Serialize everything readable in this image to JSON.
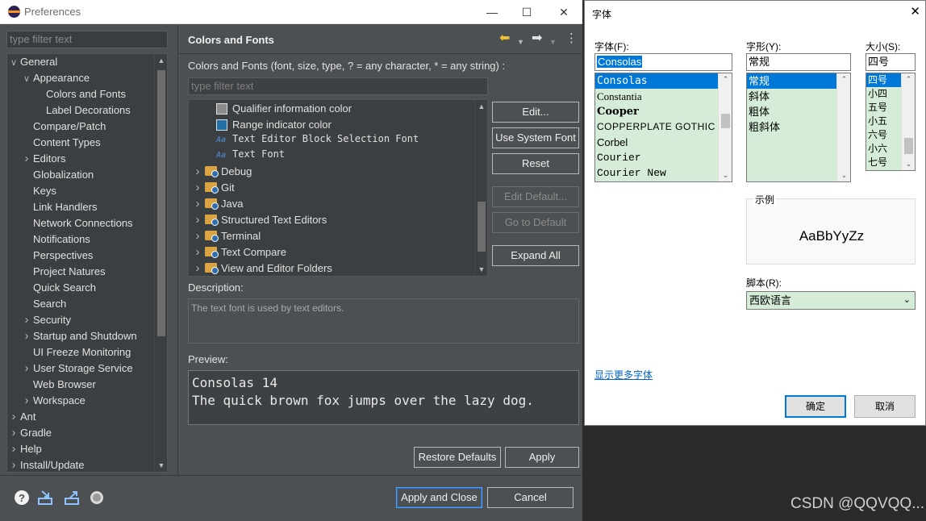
{
  "preferences": {
    "window_title": "Preferences",
    "filter_placeholder": "type filter text",
    "tree_items": [
      {
        "label": "General",
        "indent": 0,
        "arrow": "expanded"
      },
      {
        "label": "Appearance",
        "indent": 1,
        "arrow": "expanded"
      },
      {
        "label": "Colors and Fonts",
        "indent": 2,
        "arrow": "none"
      },
      {
        "label": "Label Decorations",
        "indent": 2,
        "arrow": "none"
      },
      {
        "label": "Compare/Patch",
        "indent": 1,
        "arrow": "none"
      },
      {
        "label": "Content Types",
        "indent": 1,
        "arrow": "none"
      },
      {
        "label": "Editors",
        "indent": 1,
        "arrow": "collapsed"
      },
      {
        "label": "Globalization",
        "indent": 1,
        "arrow": "none"
      },
      {
        "label": "Keys",
        "indent": 1,
        "arrow": "none"
      },
      {
        "label": "Link Handlers",
        "indent": 1,
        "arrow": "none"
      },
      {
        "label": "Network Connections",
        "indent": 1,
        "arrow": "none"
      },
      {
        "label": "Notifications",
        "indent": 1,
        "arrow": "none"
      },
      {
        "label": "Perspectives",
        "indent": 1,
        "arrow": "none"
      },
      {
        "label": "Project Natures",
        "indent": 1,
        "arrow": "none"
      },
      {
        "label": "Quick Search",
        "indent": 1,
        "arrow": "none"
      },
      {
        "label": "Search",
        "indent": 1,
        "arrow": "none"
      },
      {
        "label": "Security",
        "indent": 1,
        "arrow": "collapsed"
      },
      {
        "label": "Startup and Shutdown",
        "indent": 1,
        "arrow": "collapsed"
      },
      {
        "label": "UI Freeze Monitoring",
        "indent": 1,
        "arrow": "none"
      },
      {
        "label": "User Storage Service",
        "indent": 1,
        "arrow": "collapsed"
      },
      {
        "label": "Web Browser",
        "indent": 1,
        "arrow": "none"
      },
      {
        "label": "Workspace",
        "indent": 1,
        "arrow": "collapsed"
      },
      {
        "label": "Ant",
        "indent": 0,
        "arrow": "collapsed"
      },
      {
        "label": "Gradle",
        "indent": 0,
        "arrow": "collapsed"
      },
      {
        "label": "Help",
        "indent": 0,
        "arrow": "collapsed"
      },
      {
        "label": "Install/Update",
        "indent": 0,
        "arrow": "collapsed"
      }
    ],
    "page_title": "Colors and Fonts",
    "intro": "Colors and Fonts (font, size, type, ? = any character, * = any string) :",
    "cf_filter_placeholder": "type filter text",
    "cf_items": [
      {
        "kind": "color",
        "label": "Qualifier information color",
        "color": "#8c8c8c"
      },
      {
        "kind": "color",
        "label": "Range indicator color",
        "color": "#1f6fa8"
      },
      {
        "kind": "font",
        "label": "Text Editor Block Selection Font",
        "icon": "Aa"
      },
      {
        "kind": "font",
        "label": "Text Font",
        "icon": "Aa"
      },
      {
        "kind": "folder",
        "label": "Debug"
      },
      {
        "kind": "folder",
        "label": "Git"
      },
      {
        "kind": "folder",
        "label": "Java"
      },
      {
        "kind": "folder",
        "label": "Structured Text Editors"
      },
      {
        "kind": "folder",
        "label": "Terminal"
      },
      {
        "kind": "folder",
        "label": "Text Compare"
      },
      {
        "kind": "folder",
        "label": "View and Editor Folders"
      }
    ],
    "buttons": {
      "edit": "Edit...",
      "use_system_font": "Use System Font",
      "reset": "Reset",
      "edit_default": "Edit Default...",
      "go_to_default": "Go to Default",
      "expand_all": "Expand All",
      "restore_defaults": "Restore Defaults",
      "apply": "Apply",
      "apply_and_close": "Apply and Close",
      "cancel": "Cancel"
    },
    "description_label": "Description:",
    "description_text": "The text font is used by text editors.",
    "preview_label": "Preview:",
    "preview_lines": [
      "Consolas 14",
      "The quick brown fox jumps over the lazy dog."
    ]
  },
  "font_dialog": {
    "title": "字体",
    "font_label": "字体(F):",
    "font_value": "Consolas",
    "fonts": [
      "Consolas",
      "Constantia",
      "Cooper",
      "COPPERPLATE GOTHIC",
      "Corbel",
      "Courier",
      "Courier New"
    ],
    "style_label": "字形(Y):",
    "style_value": "常规",
    "styles": [
      "常规",
      "斜体",
      "粗体",
      "粗斜体"
    ],
    "size_label": "大小(S):",
    "size_value": "四号",
    "sizes": [
      "四号",
      "小四",
      "五号",
      "小五",
      "六号",
      "小六",
      "七号"
    ],
    "sample_label": "示例",
    "sample_text": "AaBbYyZz",
    "script_label": "脚本(R):",
    "script_value": "西欧语言",
    "more_fonts": "显示更多字体",
    "ok": "确定",
    "cancel": "取消"
  },
  "watermark": "CSDN @QQVQQ..."
}
